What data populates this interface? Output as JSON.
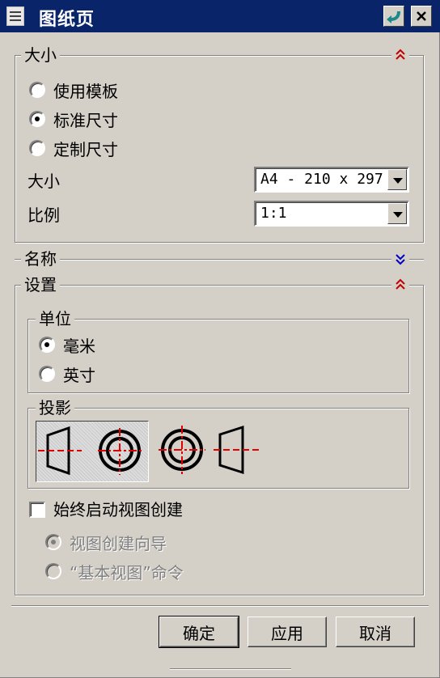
{
  "window": {
    "title": "图纸页"
  },
  "size_section": {
    "label": "大小",
    "options": [
      {
        "label": "使用模板",
        "checked": false
      },
      {
        "label": "标准尺寸",
        "checked": true
      },
      {
        "label": "定制尺寸",
        "checked": false
      }
    ],
    "size_label": "大小",
    "size_value": "A4 - 210 x 297",
    "scale_label": "比例",
    "scale_value": "1:1"
  },
  "name_section": {
    "label": "名称"
  },
  "settings_section": {
    "label": "设置",
    "units": {
      "label": "单位",
      "options": [
        {
          "label": "毫米",
          "checked": true
        },
        {
          "label": "英寸",
          "checked": false
        }
      ]
    },
    "projection": {
      "label": "投影"
    },
    "always_start_view_creation": {
      "label": "始终启动视图创建",
      "checked": false
    },
    "view_options": [
      {
        "label": "视图创建向导",
        "checked": true
      },
      {
        "label": "“基本视图”命令",
        "checked": false
      }
    ]
  },
  "buttons": {
    "ok": "确定",
    "apply": "应用",
    "cancel": "取消"
  },
  "colors": {
    "titlebar": "#0a246a",
    "face": "#d4d0c8",
    "expand_up": "#c00000",
    "expand_down": "#0000c0"
  }
}
